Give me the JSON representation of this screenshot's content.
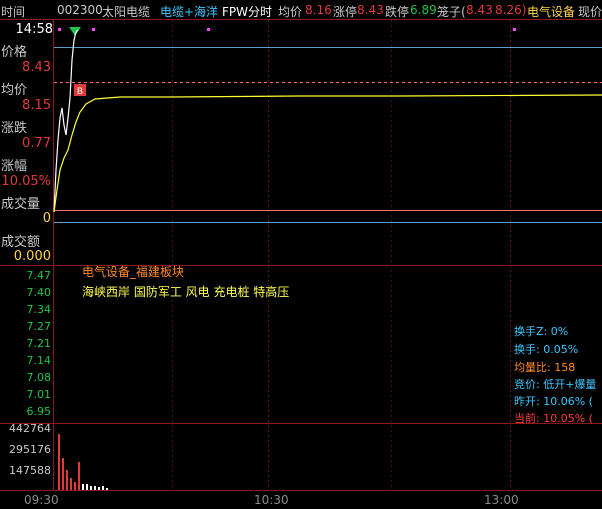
{
  "header": {
    "time_label": "时间",
    "stock_code": "002300",
    "stock_name": "太阳电缆",
    "concepts": "电缆+海洋",
    "chart_mode": "FPW分时",
    "avg_label": "均价",
    "avg_value": "8.16",
    "limit_up_label": "涨停",
    "limit_up_value": "8.43",
    "limit_down_label": "跌停",
    "limit_down_value": "6.89",
    "cage_label": "笼子(",
    "cage_low": "8.43",
    "cage_high": "8.26)",
    "sector": "电气设备",
    "current_label": "现价"
  },
  "info_panel": {
    "time": "14:58",
    "price_label": "价格",
    "price_value": "8.43",
    "avg_label": "均价",
    "avg_value": "8.15",
    "change_label": "涨跌",
    "change_value": "0.77",
    "pct_label": "涨幅",
    "pct_value": "10.05%",
    "volume_label": "成交量",
    "volume_value": "0",
    "amount_label": "成交额",
    "amount_value": "0.000"
  },
  "price_ticks": [
    "7.47",
    "7.40",
    "7.34",
    "7.27",
    "7.21",
    "7.14",
    "7.08",
    "7.01",
    "6.95"
  ],
  "volume_ticks": [
    "442764",
    "295176",
    "147588"
  ],
  "time_ticks": [
    "09:30",
    "10:30",
    "13:00"
  ],
  "annotations": {
    "sector_line": "电气设备_福建板块",
    "concept_line": "海峡西岸 国防军工 风电 充电桩 特高压",
    "buy_marker": "B"
  },
  "stats": {
    "turnover_z": "换手Z: 0%",
    "turnover": "换手: 0.05%",
    "volume_ratio": "均量比: 158",
    "auction": "竞价: 低开+爆量",
    "prev_open": "昨开: 10.06%  (",
    "current": "当前: 10.05%  ("
  },
  "chart_data": {
    "type": "line",
    "series": [
      {
        "values": [
          6.95,
          7.6,
          7.9,
          7.7,
          8.1,
          8.43,
          8.43,
          8.43,
          8.43
        ]
      },
      {
        "values": [
          6.95,
          7.3,
          7.7,
          7.95,
          8.05,
          8.1,
          8.13,
          8.14,
          8.15
        ]
      }
    ],
    "colors": {
      "price": "#ffffff",
      "avg": "#ffff33",
      "limit_line": "#ff6a6a",
      "grid": "#5aa0c8"
    }
  }
}
